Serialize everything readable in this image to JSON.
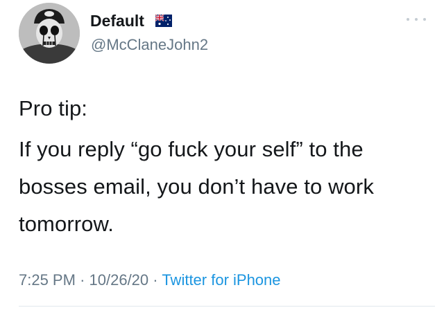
{
  "author": {
    "display_name": "Default",
    "handle": "@McClaneJohn2",
    "flag_icon": "australia-flag-icon"
  },
  "tweet": {
    "lines": [
      "Pro tip:",
      "If you reply “go fuck your self” to the",
      "bosses email, you don’t have to work",
      "tomorrow."
    ],
    "time": "7:25 PM",
    "separator": "·",
    "date": "10/26/20",
    "source": "Twitter for iPhone"
  },
  "colors": {
    "text": "#14171a",
    "secondary": "#657786",
    "link": "#1b95e0",
    "divider": "#e1e8ed"
  }
}
